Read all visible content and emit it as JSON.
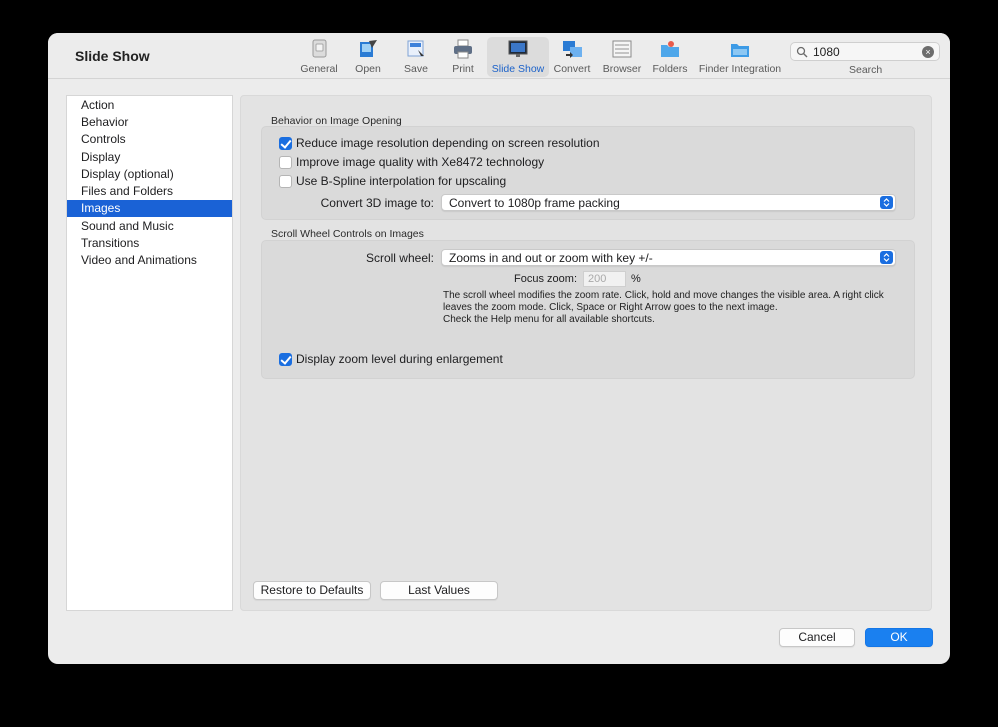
{
  "window": {
    "title": "Slide Show"
  },
  "toolbar": {
    "items": [
      {
        "label": "General",
        "icon": "general-icon"
      },
      {
        "label": "Open",
        "icon": "open-icon"
      },
      {
        "label": "Save",
        "icon": "save-icon"
      },
      {
        "label": "Print",
        "icon": "print-icon"
      },
      {
        "label": "Slide Show",
        "icon": "slide-show-icon",
        "active": true
      },
      {
        "label": "Convert",
        "icon": "convert-icon"
      },
      {
        "label": "Browser",
        "icon": "browser-icon"
      },
      {
        "label": "Folders",
        "icon": "folders-icon"
      },
      {
        "label": "Finder Integration",
        "icon": "finder-integration-icon"
      }
    ]
  },
  "search": {
    "value": "1080",
    "label": "Search"
  },
  "sidebar": {
    "items": [
      {
        "label": "Action"
      },
      {
        "label": "Behavior"
      },
      {
        "label": "Controls"
      },
      {
        "label": "Display"
      },
      {
        "label": "Display (optional)"
      },
      {
        "label": "Files and Folders"
      },
      {
        "label": "Images",
        "selected": true
      },
      {
        "label": "Sound and Music"
      },
      {
        "label": "Transitions"
      },
      {
        "label": "Video and Animations"
      }
    ]
  },
  "behavior": {
    "title": "Behavior on Image Opening",
    "options": [
      {
        "label": "Reduce image resolution depending on screen resolution",
        "checked": true
      },
      {
        "label": "Improve image quality with Xe8472 technology",
        "checked": false
      },
      {
        "label": "Use B-Spline interpolation for upscaling",
        "checked": false
      }
    ],
    "convert_label": "Convert 3D image to:",
    "convert_value": "Convert to 1080p frame packing"
  },
  "scroll": {
    "title": "Scroll Wheel Controls on Images",
    "wheel_label": "Scroll wheel:",
    "wheel_value": "Zooms in and out or zoom with key +/-",
    "focus_label": "Focus zoom:",
    "focus_value": "200",
    "focus_unit": "%",
    "help_lines": [
      "The scroll wheel modifies the zoom rate. Click, hold and move changes the visible area. A right click",
      "leaves the zoom mode. Click, Space or Right Arrow goes to the next image.",
      "Check the Help menu for all available shortcuts."
    ],
    "display_zoom": {
      "label": "Display zoom level during enlargement",
      "checked": true
    }
  },
  "buttons": {
    "restore": "Restore to Defaults",
    "last_values": "Last Values",
    "cancel": "Cancel",
    "ok": "OK"
  },
  "colors": {
    "accent": "#1a62d6",
    "ok_button": "#1a80f0"
  }
}
